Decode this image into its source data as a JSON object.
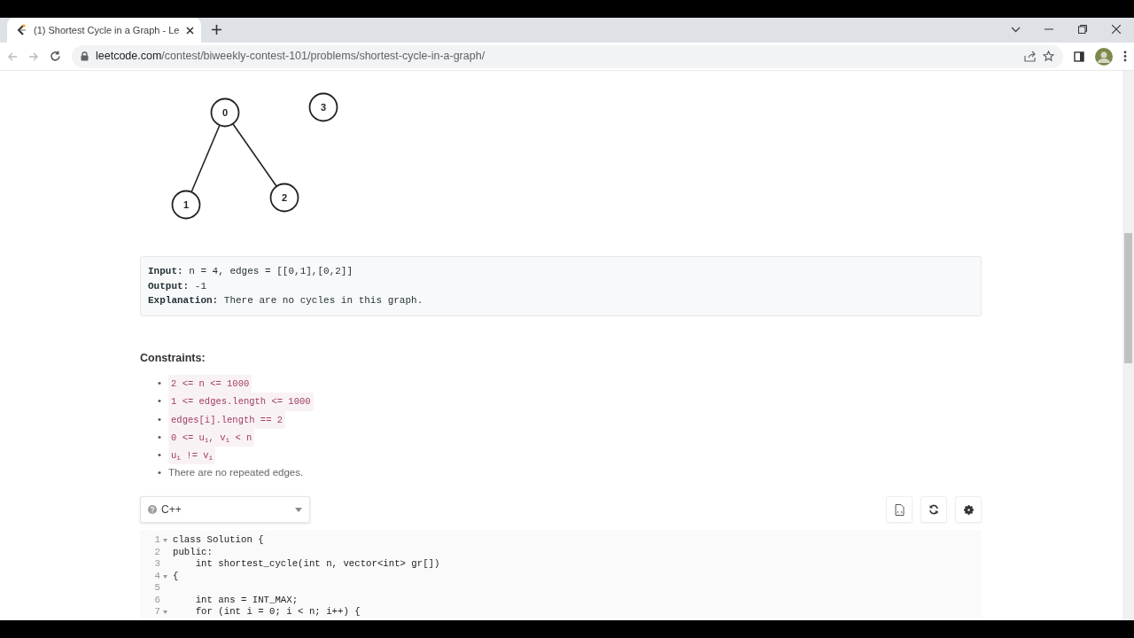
{
  "browser": {
    "tabs": [
      {
        "title": "(1) Shortest Cycle in a Graph - Le",
        "selected": true
      }
    ],
    "url_host": "leetcode.com",
    "url_path": "/contest/biweekly-contest-101/problems/shortest-cycle-in-a-graph/"
  },
  "graph": {
    "nodes": [
      {
        "label": "0"
      },
      {
        "label": "3"
      },
      {
        "label": "1"
      },
      {
        "label": "2"
      }
    ]
  },
  "example": {
    "lines": [
      "**Input:** n = 4, edges = [[0,1],[0,2]]",
      "**Output:** -1",
      "**Explanation:** There are no cycles in this graph."
    ]
  },
  "constraints": {
    "title": "Constraints:",
    "items": [
      {
        "bullet": "•",
        "kind": "code",
        "text": "2 <= n <= 1000"
      },
      {
        "bullet": "•",
        "kind": "code",
        "text": "1 <= edges.length <= 1000"
      },
      {
        "bullet": "•",
        "kind": "code",
        "text": "edges[i].length == 2"
      },
      {
        "bullet": "•",
        "kind": "code",
        "text": "0 <= u$_{i}$, v$_{i}$ < n"
      },
      {
        "bullet": "•",
        "kind": "code",
        "text": "u$_{i}$ != v$_{i}$"
      },
      {
        "bullet": "•",
        "kind": "text",
        "text": "There are no repeated edges."
      }
    ]
  },
  "editor": {
    "language": "C++",
    "lines": [
      {
        "number": "1",
        "foldable": true,
        "code": "class Solution {"
      },
      {
        "number": "2",
        "foldable": false,
        "code": "public:"
      },
      {
        "number": "3",
        "foldable": false,
        "code": "    int shortest_cycle(int n, vector<int> gr[])"
      },
      {
        "number": "4",
        "foldable": true,
        "code": "{"
      },
      {
        "number": "5",
        "foldable": false
      },
      {
        "number": "6",
        "foldable": false,
        "code": "    int ans = INT_MAX;"
      },
      {
        "number": "7",
        "foldable": true,
        "code": "    for (int i = 0; i < n; i++) {"
      }
    ]
  }
}
